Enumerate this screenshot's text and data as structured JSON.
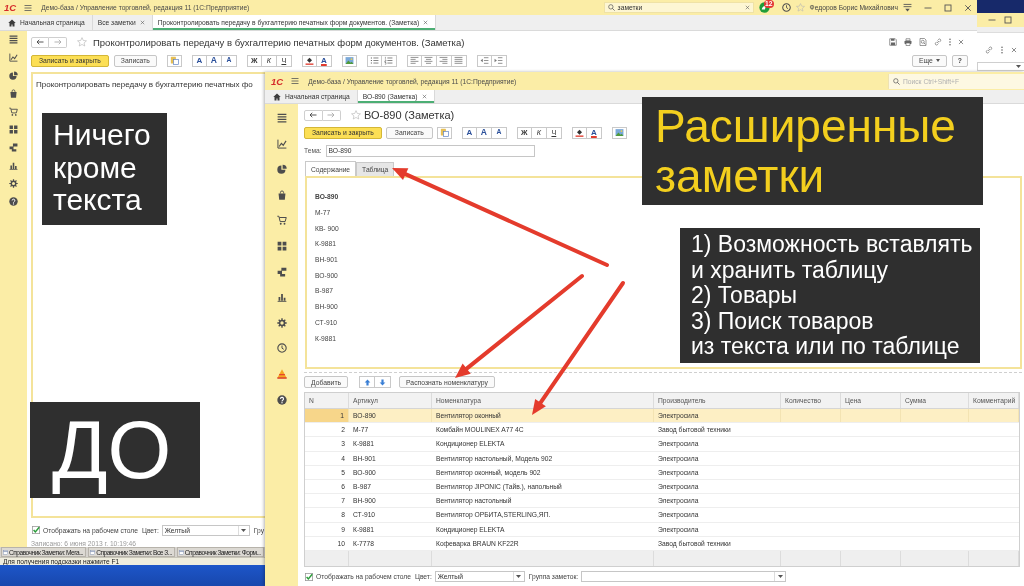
{
  "back_window": {
    "logo": "1С",
    "title": "Демо-база / Управление торговлей, редакция 11  (1С:Предприятие)",
    "search": {
      "value": "заметки"
    },
    "notifications": "12",
    "user": "Федоров Борис Михайлович",
    "tabs": [
      {
        "label": "Начальная страница",
        "kind": "home",
        "selected": false
      },
      {
        "label": "Все заметки",
        "kind": "closable",
        "selected": false
      },
      {
        "label": "Проконтролировать передачу в бухгалтерию печатных форм документов. (Заметка)",
        "kind": "closable",
        "selected": true
      }
    ],
    "heading": "Проконтролировать передачу в бухгалтерию печатных форм документов. (Заметка)",
    "buttons": {
      "save_close": "Записать и закрыть",
      "save": "Записать",
      "more": "Еще",
      "help": "?"
    },
    "tool_groups": [
      [
        {
          "kind": "paste"
        }
      ],
      [
        {
          "kind": "font",
          "label": "A"
        },
        {
          "kind": "grow",
          "label": "A"
        },
        {
          "kind": "shrink",
          "label": "A"
        }
      ],
      [
        {
          "kind": "bold",
          "label": "Ж"
        },
        {
          "kind": "italic",
          "label": "К"
        },
        {
          "kind": "underline",
          "label": "Ч"
        }
      ],
      [
        {
          "kind": "fill-color"
        },
        {
          "kind": "font-color",
          "label": "A"
        }
      ],
      [
        {
          "kind": "picture"
        }
      ],
      [
        {
          "kind": "bullets"
        },
        {
          "kind": "numbering"
        }
      ],
      [
        {
          "kind": "align-left"
        },
        {
          "kind": "align-center"
        },
        {
          "kind": "align-right"
        },
        {
          "kind": "justify"
        }
      ],
      [
        {
          "kind": "outdent"
        },
        {
          "kind": "indent"
        }
      ]
    ],
    "body_text": "Проконтролировать передачу в бухгалтерию печатных фо",
    "show_on_desktop": {
      "label": "Отображать на рабочем столе",
      "checked": true
    },
    "color": {
      "label": "Цвет:",
      "value": "Желтый"
    },
    "group_label": "Гру",
    "saved": "Записано: 6 июня 2013 г. 10:19:46"
  },
  "legacy_app": {
    "tasks": [
      "Справочник Заметки: Мега...",
      "Справочник Заметки: Все З...",
      "Справочник Заметки: Форм..."
    ],
    "status": "Для получения подсказки нажмите F1"
  },
  "front_window": {
    "logo": "1С",
    "title": "Демо-база / Управление торговлей, редакция 11  (1С:Предприятие)",
    "search": {
      "placeholder": "Поиск Ctrl+Shift+F"
    },
    "tabs": [
      {
        "label": "Начальная страница",
        "kind": "home",
        "selected": false
      },
      {
        "label": "ВО-890 (Заметка)",
        "kind": "closable",
        "selected": true
      }
    ],
    "heading": "ВО-890 (Заметка)",
    "buttons": {
      "save_close": "Записать и закрыть",
      "save": "Записать"
    },
    "tool_groups": [
      [
        {
          "kind": "paste"
        }
      ],
      [
        {
          "kind": "font",
          "label": "A"
        },
        {
          "kind": "grow",
          "label": "A"
        },
        {
          "kind": "shrink",
          "label": "A"
        }
      ],
      [
        {
          "kind": "bold",
          "label": "Ж"
        },
        {
          "kind": "italic",
          "label": "К"
        },
        {
          "kind": "underline",
          "label": "Ч"
        }
      ],
      [
        {
          "kind": "fill-color"
        },
        {
          "kind": "font-color",
          "label": "A"
        }
      ],
      [
        {
          "kind": "picture"
        }
      ]
    ],
    "subject": {
      "label": "Тема:",
      "value": "ВО-890"
    },
    "content_tabs": [
      {
        "label": "Содержание",
        "selected": true
      },
      {
        "label": "Таблица",
        "selected": false
      }
    ],
    "content_lines": [
      {
        "text": "ВО-890",
        "bold": true
      },
      {
        "text": "М-77",
        "bold": false
      },
      {
        "text": "КВ- 900",
        "bold": false
      },
      {
        "text": "К-9881",
        "bold": false
      },
      {
        "text": "ВН-901",
        "bold": false
      },
      {
        "text": "ВО-900",
        "bold": false
      },
      {
        "text": "В-987",
        "bold": false
      },
      {
        "text": "ВН-900",
        "bold": false
      },
      {
        "text": "СТ-910",
        "bold": false
      },
      {
        "text": "К-9881",
        "bold": false
      }
    ],
    "table_buttons": {
      "add": "Добавить",
      "recognize": "Распознать номенклатуру"
    },
    "table": {
      "columns": [
        "N",
        "Артикул",
        "Номенклатура",
        "Производитель",
        "Количество",
        "Цена",
        "Сумма",
        "Комментарий"
      ],
      "rows": [
        {
          "n": "1",
          "article": "ВО-890",
          "item": "Вентилятор оконный",
          "maker": "Электросила",
          "selected": true
        },
        {
          "n": "2",
          "article": "М-77",
          "item": "Комбайн MOULINEX  A77 4C",
          "maker": "Завод бытовой техники",
          "selected": false
        },
        {
          "n": "3",
          "article": "К-9881",
          "item": "Кондиционер ELEKTA",
          "maker": "Электросила",
          "selected": false
        },
        {
          "n": "4",
          "article": "ВН-901",
          "item": "Вентилятор настольный, Модель 902",
          "maker": "Электросила",
          "selected": false
        },
        {
          "n": "5",
          "article": "ВО-900",
          "item": "Вентилятор оконный, модель 902",
          "maker": "Электросила",
          "selected": false
        },
        {
          "n": "6",
          "article": "В-987",
          "item": "Вентилятор JIPONIC (Тайв.), напольный",
          "maker": "Электросила",
          "selected": false
        },
        {
          "n": "7",
          "article": "ВН-900",
          "item": "Вентилятор настольный",
          "maker": "Электросила",
          "selected": false
        },
        {
          "n": "8",
          "article": "СТ-910",
          "item": "Вентилятор ОРБИТА,STERLING,ЯП.",
          "maker": "Электросила",
          "selected": false
        },
        {
          "n": "9",
          "article": "К-9881",
          "item": "Кондиционер ELEKTA",
          "maker": "Электросила",
          "selected": false
        },
        {
          "n": "10",
          "article": "К-7778",
          "item": "Кофеварка BRAUN KF22R",
          "maker": "Завод бытовой техники",
          "selected": false
        }
      ]
    },
    "show_on_desktop": {
      "label": "Отображать на рабочем столе",
      "checked": true
    },
    "color": {
      "label": "Цвет:",
      "value": "Желтый"
    },
    "group": {
      "label": "Группа заметок:"
    }
  },
  "annotations": [
    {
      "kind": "title",
      "text": "Расширенные\nзаметки"
    },
    {
      "kind": "list",
      "text": "1) Возможность вставлять\nи хранить таблицу\n2) Товары\n3) Поиск товаров\nиз текста или по таблице"
    },
    {
      "kind": "note",
      "text": "Ничего\nкроме\nтекста"
    },
    {
      "kind": "stamp",
      "text": "ДО"
    }
  ]
}
